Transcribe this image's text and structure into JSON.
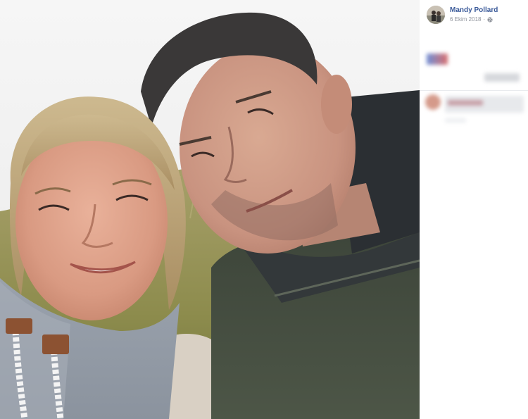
{
  "post": {
    "author_name": "Mandy Pollard",
    "date": "6 Ekim 2018",
    "separator": "·",
    "privacy_icon": "globe-icon",
    "avatar_icon": "profile-photo"
  },
  "photo": {
    "description_icon": "selfie-photo"
  },
  "colors": {
    "author_link": "#385898",
    "meta_text": "#90949c"
  }
}
